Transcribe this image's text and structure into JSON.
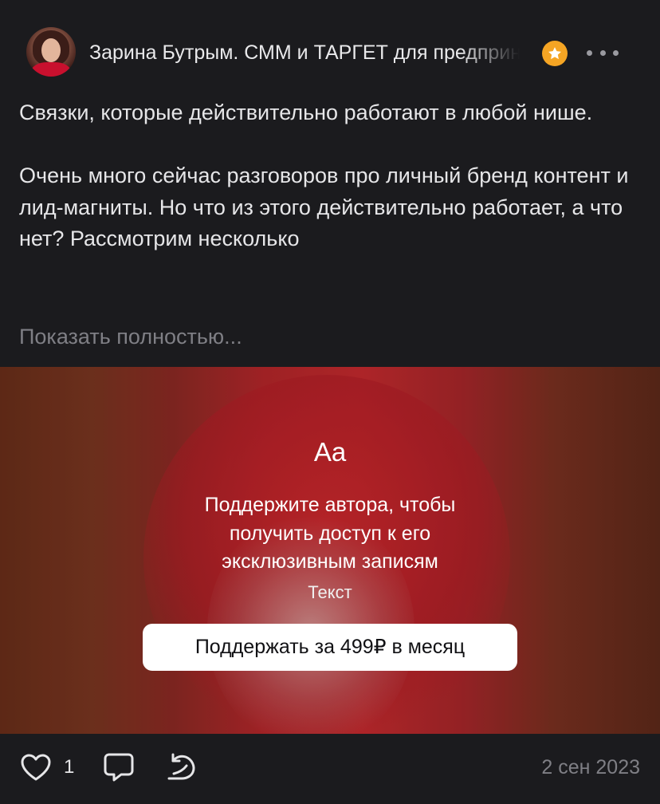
{
  "author": {
    "name": "Зарина Бутрым. СММ и ТАРГЕТ для предпринимателей"
  },
  "post": {
    "paragraph_1": "Связки, которые действительно работают в любой нише.",
    "paragraph_2": "Очень много сейчас разговоров про личный бренд контент и лид-магниты. Но что из этого действительно работает, а что нет? Рассмотрим несколько",
    "show_more": "Показать полностью..."
  },
  "paywall": {
    "icon_text": "Aa",
    "message": "Поддержите автора, чтобы получить доступ к его эксклюзивным записям",
    "content_type": "Текст",
    "button_label": "Поддержать за 499₽ в месяц"
  },
  "footer": {
    "like_count": "1",
    "date": "2 сен 2023"
  },
  "colors": {
    "background": "#1b1b1e",
    "badge": "#f5a524",
    "muted_text": "#7f7f85"
  },
  "icons": [
    "star-badge-icon",
    "more-icon",
    "like-icon",
    "comment-icon",
    "repost-icon"
  ]
}
